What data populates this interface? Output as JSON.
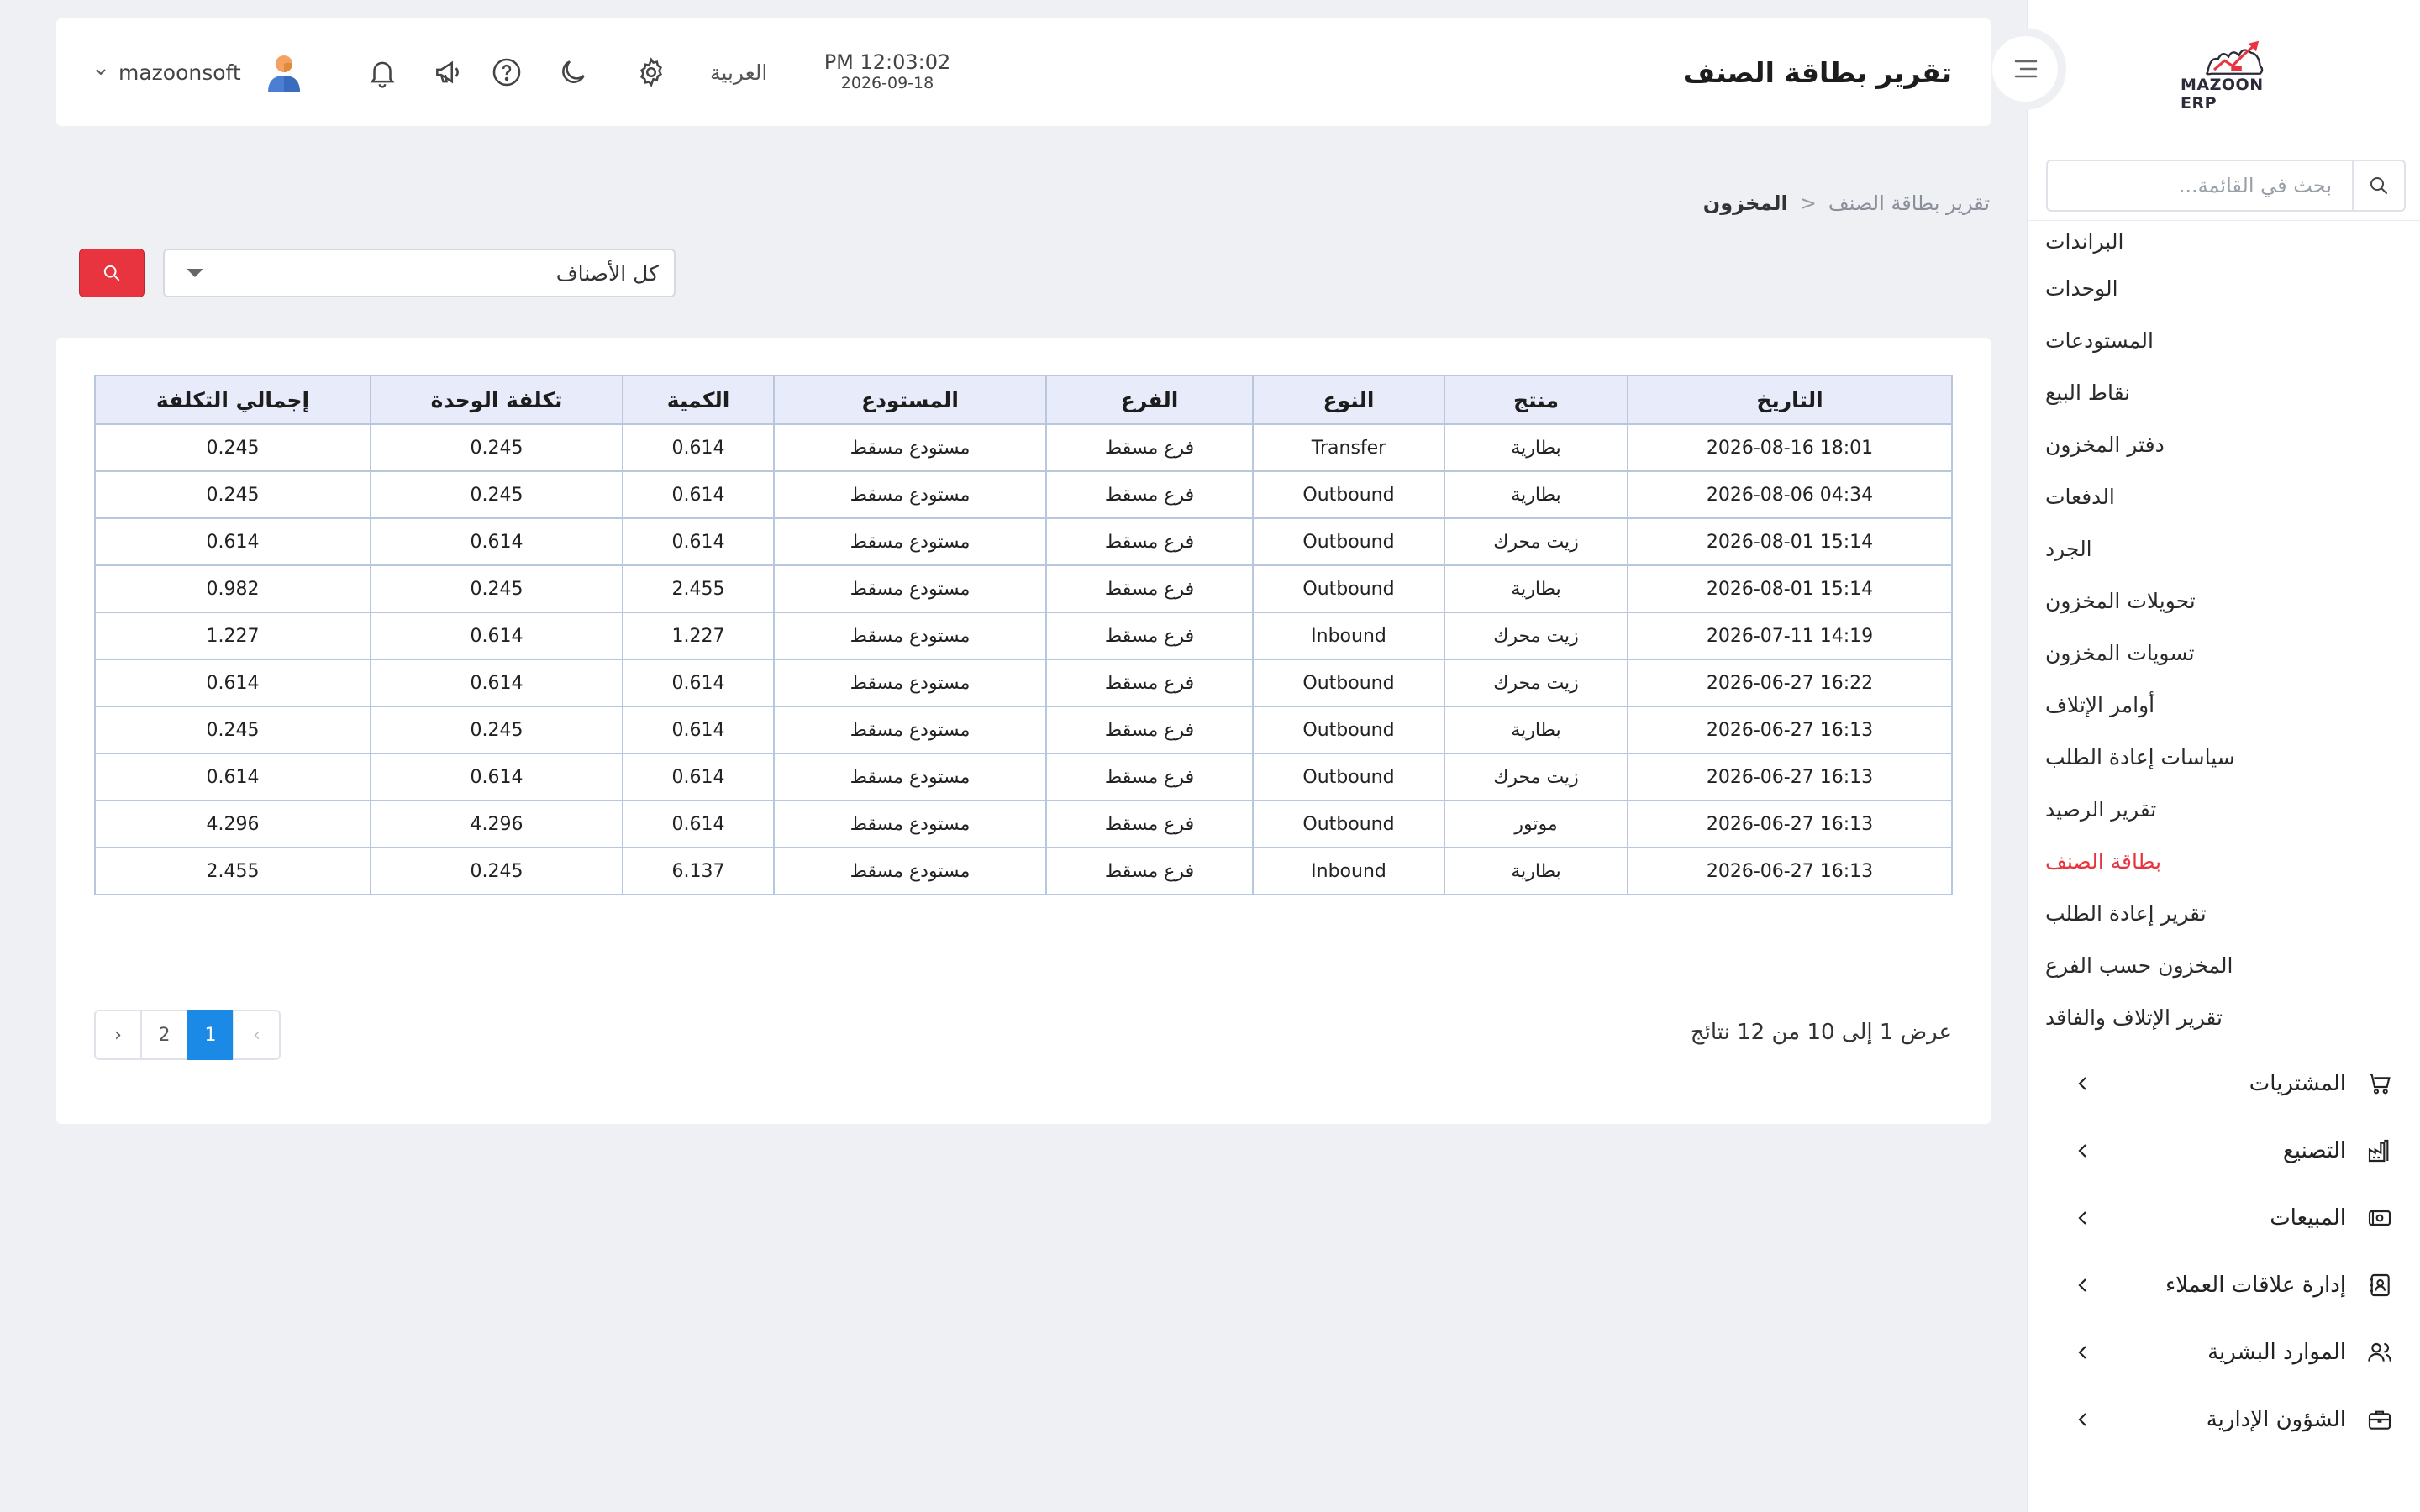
{
  "app": {
    "logo_text": "MAZOON ERP",
    "accent_color": "#e8343f",
    "primary_color": "#1a8ae6"
  },
  "header": {
    "title": "تقرير بطاقة الصنف",
    "time": "PM 12:03:02",
    "date": "2026-09-18",
    "language": "العربية",
    "username": "mazoonsoft"
  },
  "sidebar": {
    "search_placeholder": "بحث في القائمة...",
    "inventory_items": [
      {
        "label": "البراندات",
        "active": false
      },
      {
        "label": "الوحدات",
        "active": false
      },
      {
        "label": "المستودعات",
        "active": false
      },
      {
        "label": "نقاط البيع",
        "active": false
      },
      {
        "label": "دفتر المخزون",
        "active": false
      },
      {
        "label": "الدفعات",
        "active": false
      },
      {
        "label": "الجرد",
        "active": false
      },
      {
        "label": "تحويلات المخزون",
        "active": false
      },
      {
        "label": "تسويات المخزون",
        "active": false
      },
      {
        "label": "أوامر الإتلاف",
        "active": false
      },
      {
        "label": "سياسات إعادة الطلب",
        "active": false
      },
      {
        "label": "تقرير الرصيد",
        "active": false
      },
      {
        "label": "بطاقة الصنف",
        "active": true
      },
      {
        "label": "تقرير إعادة الطلب",
        "active": false
      },
      {
        "label": "المخزون حسب الفرع",
        "active": false
      },
      {
        "label": "تقرير الإتلاف والفاقد",
        "active": false
      }
    ],
    "groups": [
      {
        "label": "المشتريات",
        "icon": "cart-icon"
      },
      {
        "label": "التصنيع",
        "icon": "factory-icon"
      },
      {
        "label": "المبيعات",
        "icon": "cash-icon"
      },
      {
        "label": "إدارة علاقات العملاء",
        "icon": "contacts-icon"
      },
      {
        "label": "الموارد البشرية",
        "icon": "users-icon"
      },
      {
        "label": "الشؤون الإدارية",
        "icon": "briefcase-icon"
      }
    ]
  },
  "breadcrumb": {
    "root": "المخزون",
    "separator": "<",
    "current": "تقرير بطاقة الصنف"
  },
  "filter": {
    "selected": "كل الأصناف"
  },
  "table": {
    "headers": [
      "التاريخ",
      "منتج",
      "النوع",
      "الفرع",
      "المستودع",
      "الكمية",
      "تكلفة الوحدة",
      "إجمالي التكلفة"
    ],
    "rows": [
      [
        "2026-08-16 18:01",
        "بطارية",
        "Transfer",
        "فرع مسقط",
        "مستودع مسقط",
        "0.614",
        "0.245",
        "0.245"
      ],
      [
        "2026-08-06 04:34",
        "بطارية",
        "Outbound",
        "فرع مسقط",
        "مستودع مسقط",
        "0.614",
        "0.245",
        "0.245"
      ],
      [
        "2026-08-01 15:14",
        "زيت محرك",
        "Outbound",
        "فرع مسقط",
        "مستودع مسقط",
        "0.614",
        "0.614",
        "0.614"
      ],
      [
        "2026-08-01 15:14",
        "بطارية",
        "Outbound",
        "فرع مسقط",
        "مستودع مسقط",
        "2.455",
        "0.245",
        "0.982"
      ],
      [
        "2026-07-11 14:19",
        "زيت محرك",
        "Inbound",
        "فرع مسقط",
        "مستودع مسقط",
        "1.227",
        "0.614",
        "1.227"
      ],
      [
        "2026-06-27 16:22",
        "زيت محرك",
        "Outbound",
        "فرع مسقط",
        "مستودع مسقط",
        "0.614",
        "0.614",
        "0.614"
      ],
      [
        "2026-06-27 16:13",
        "بطارية",
        "Outbound",
        "فرع مسقط",
        "مستودع مسقط",
        "0.614",
        "0.245",
        "0.245"
      ],
      [
        "2026-06-27 16:13",
        "زيت محرك",
        "Outbound",
        "فرع مسقط",
        "مستودع مسقط",
        "0.614",
        "0.614",
        "0.614"
      ],
      [
        "2026-06-27 16:13",
        "موتور",
        "Outbound",
        "فرع مسقط",
        "مستودع مسقط",
        "0.614",
        "4.296",
        "4.296"
      ],
      [
        "2026-06-27 16:13",
        "بطارية",
        "Inbound",
        "فرع مسقط",
        "مستودع مسقط",
        "6.137",
        "0.245",
        "2.455"
      ]
    ]
  },
  "pagination": {
    "summary": "عرض 1 إلى 10 من 12 نتائج",
    "prev": "‹",
    "pages": [
      "1",
      "2"
    ],
    "current": "1",
    "next": "›"
  }
}
